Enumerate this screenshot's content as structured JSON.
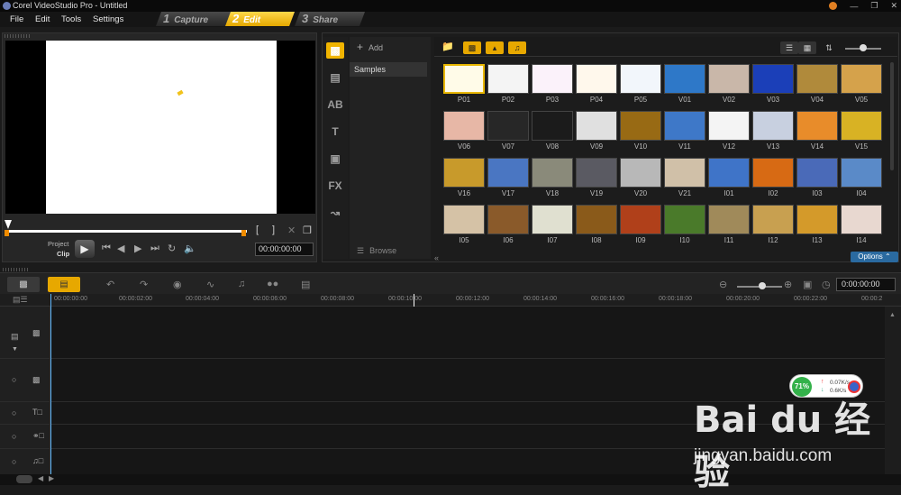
{
  "window": {
    "title": "Corel VideoStudio Pro - Untitled"
  },
  "menu": {
    "items": [
      "File",
      "Edit",
      "Tools",
      "Settings"
    ]
  },
  "steps": [
    {
      "num": "1",
      "label": "Capture"
    },
    {
      "num": "2",
      "label": "Edit"
    },
    {
      "num": "3",
      "label": "Share"
    }
  ],
  "preview": {
    "project_label": "Project",
    "clip_label": "Clip",
    "timecode": "00:00:00:00",
    "in_bracket": "[",
    "out_bracket": "]"
  },
  "library": {
    "add_label": "Add",
    "folder": "Samples",
    "browse_label": "Browse",
    "options_label": "Options",
    "rows": [
      [
        "P01",
        "P02",
        "P03",
        "P04",
        "P05",
        "V01",
        "V02",
        "V03",
        "V04",
        "V05"
      ],
      [
        "V06",
        "V07",
        "V08",
        "V09",
        "V10",
        "V11",
        "V12",
        "V13",
        "V14",
        "V15"
      ],
      [
        "V16",
        "V17",
        "V18",
        "V19",
        "V20",
        "V21",
        "I01",
        "I02",
        "I03",
        "I04"
      ],
      [
        "I05",
        "I06",
        "I07",
        "I08",
        "I09",
        "I10",
        "I11",
        "I12",
        "I13",
        "I14"
      ]
    ],
    "colors": [
      [
        "#fffbe8",
        "#f4f4f4",
        "#fbf2fa",
        "#fff8ec",
        "#f2f6fb",
        "#2e78c8",
        "#c9b7a9",
        "#1b3fb8",
        "#b08a3b",
        "#d5a24b"
      ],
      [
        "#e7b7a6",
        "#272727",
        "#1b1b1b",
        "#e0e0e0",
        "#986a14",
        "#3e78c8",
        "#f4f4f4",
        "#c8d0e0",
        "#e88c2a",
        "#d8b224"
      ],
      [
        "#c89a2b",
        "#4a76c2",
        "#8a8a7a",
        "#5a5a62",
        "#b8b8b8",
        "#d0c0a8",
        "#3f74c8",
        "#d76a14",
        "#4a6ab8",
        "#5a8ac8"
      ],
      [
        "#d5c2a6",
        "#8a5a2a",
        "#e0e0d0",
        "#8a5a1a",
        "#b0401a",
        "#4a7a2a",
        "#a08a5a",
        "#c8a050",
        "#d49a2a",
        "#e8d8d0"
      ]
    ]
  },
  "timeline": {
    "timecode": "0:00:00:00",
    "ticks": [
      "00:00:00:00",
      "00:00:02:00",
      "00:00:04:00",
      "00:00:06:00",
      "00:00:08:00",
      "00:00:10:00",
      "00:00:12:00",
      "00:00:14:00",
      "00:00:16:00",
      "00:00:18:00",
      "00:00:20:00",
      "00:00:22:00",
      "00:00:2"
    ]
  },
  "network": {
    "percent": "71%",
    "up": "0.07K/s",
    "down": "0.6K/s"
  },
  "watermark": {
    "brand": "Bai du 经验",
    "url": "jingyan.baidu.com"
  }
}
